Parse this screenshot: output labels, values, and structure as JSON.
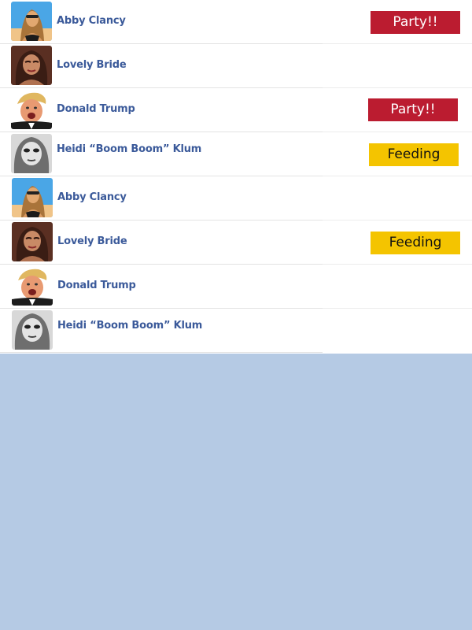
{
  "rows": [
    {
      "name": "Abby Clancy",
      "avatar": "abby-clancy-avatar",
      "status": "Party!!"
    },
    {
      "name": "Lovely Bride",
      "avatar": "lovely-bride-avatar",
      "status": ""
    },
    {
      "name": "Donald Trump",
      "avatar": "donald-trump-avatar",
      "status": "Party!!"
    },
    {
      "name": "Heidi “Boom Boom” Klum",
      "avatar": "heidi-klum-avatar",
      "status": "Feeding"
    },
    {
      "name": "Abby Clancy",
      "avatar": "abby-clancy-avatar",
      "status": ""
    },
    {
      "name": "Lovely Bride",
      "avatar": "lovely-bride-avatar",
      "status": "Feeding"
    },
    {
      "name": "Donald Trump",
      "avatar": "donald-trump-avatar",
      "status": ""
    },
    {
      "name": "Heidi “Boom Boom” Klum",
      "avatar": "heidi-klum-avatar",
      "status": ""
    }
  ],
  "colors": {
    "name_text": "#3b5a9a",
    "party_badge": "#bb1c30",
    "feeding_badge": "#f4c400",
    "page_background": "#b5cae4"
  }
}
